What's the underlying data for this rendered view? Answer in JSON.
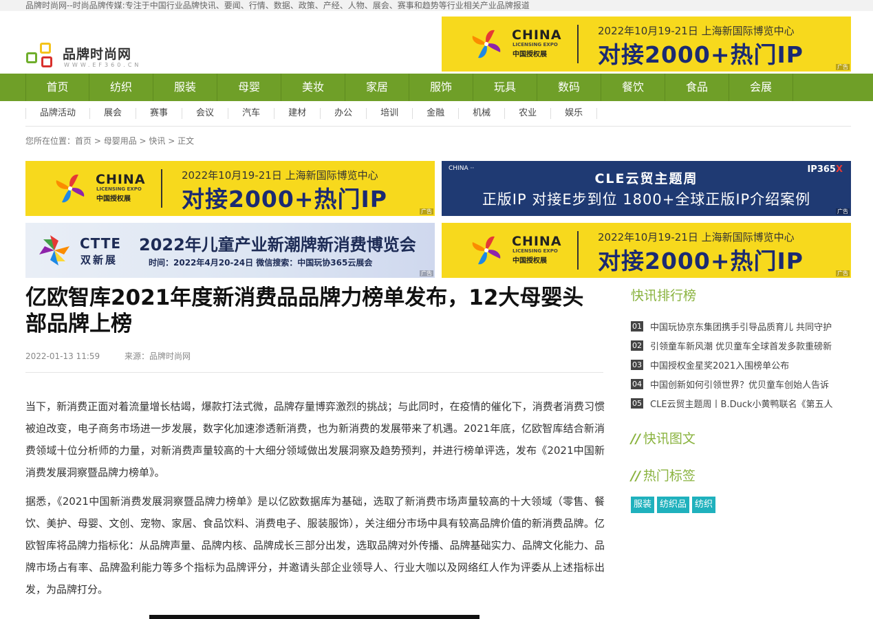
{
  "topbar": {
    "text": "品牌时尚网--时尚品牌传媒:专注于中国行业品牌快讯、要闻、行情、数据、政策、产经、人物、展会、赛事和趋势等行业相关产业品牌报道"
  },
  "logo": {
    "name": "品牌时尚网",
    "url": "WWW.EF360.CN"
  },
  "ad_yellow": {
    "china": "CHINA",
    "licensing": "LICENSING EXPO",
    "cn": "中国授权展",
    "date": "2022年10月19-21日 上海新国际博览中心",
    "headline": "对接2000+热门IP",
    "tag": "广告"
  },
  "ad_blue": {
    "title": "CLE云贸主题周",
    "subtitle": "正版IP 对接E步到位 1800+全球正版IP介绍案例",
    "brand": "IP365",
    "brand_x": "X",
    "logos": "CHINA ·· ",
    "tag": "广告"
  },
  "ad_ctte": {
    "en": "CTTE",
    "cn": "双新展",
    "title": "2022年儿童产业新潮牌新消费博览会",
    "info": "时间：2022年4月20-24日    微信搜索：中国玩协365云展会",
    "tag": "广告"
  },
  "nav": [
    "首页",
    "纺织",
    "服装",
    "母婴",
    "美妆",
    "家居",
    "服饰",
    "玩具",
    "数码",
    "餐饮",
    "食品",
    "会展"
  ],
  "subnav": [
    "品牌活动",
    "展会",
    "赛事",
    "会议",
    "汽车",
    "建材",
    "办公",
    "培训",
    "金融",
    "机械",
    "农业",
    "娱乐"
  ],
  "breadcrumb": {
    "prefix": "您所在位置：",
    "items": [
      "首页",
      "母婴用品",
      "快讯",
      "正文"
    ],
    "sep": " > "
  },
  "article": {
    "title": "亿欧智库2021年度新消费品品牌力榜单发布，12大母婴头部品牌上榜",
    "date": "2022-01-13 11:59",
    "source": "来源：品牌时尚网",
    "paragraphs": [
      "当下，新消费正面对着流量增长枯竭，爆款打法式微，品牌存量博弈激烈的挑战；与此同时，在疫情的催化下，消费者消费习惯被迫改变，电子商务市场进一步发展，数字化加速渗透新消费，也为新消费的发展带来了机遇。2021年底，亿欧智库结合新消费领域十位分析师的力量，对新消费声量较高的十大细分领域做出发展洞察及趋势预判，并进行榜单评选，发布《2021中国新消费发展洞察暨品牌力榜单》。",
      "据悉，《2021中国新消费发展洞察暨品牌力榜单》是以亿欧数据库为基础，选取了新消费市场声量较高的十大领域（零售、餐饮、美护、母婴、文创、宠物、家居、食品饮料、消费电子、服装服饰），关注细分市场中具有较高品牌价值的新消费品牌。亿欧智库将品牌力指标化：从品牌声量、品牌内核、品牌成长三部分出发，选取品牌对外传播、品牌基础实力、品牌文化能力、品牌市场占有率、品牌盈利能力等多个指标为品牌评分，并邀请头部企业领导人、行业大咖以及网络红人作为评委从上述指标出发，为品牌打分。"
    ]
  },
  "sidebar": {
    "rank_title": "快讯排行榜",
    "rank_items": [
      {
        "num": "01",
        "text": "中国玩协京东集团携手引导品质育儿 共同守护"
      },
      {
        "num": "02",
        "text": "引领童车新风潮 优贝童车全球首发多款重磅新"
      },
      {
        "num": "03",
        "text": "中国授权金星奖2021入围榜单公布"
      },
      {
        "num": "04",
        "text": "中国创新如何引领世界？优贝童车创始人告诉"
      },
      {
        "num": "05",
        "text": "CLE云贸主题周丨B.Duck小黄鸭联名《第五人"
      }
    ],
    "slashes": "//",
    "pic_title": "快讯图文",
    "tag_title": "热门标签",
    "tags": [
      "服装",
      "纺织品",
      "纺织"
    ]
  },
  "colors": {
    "nav_green": "#6f9f28",
    "accent_green": "#8ab33f",
    "tag_teal": "#1fb1bd",
    "banner_yellow": "#f7d91d",
    "banner_navy": "#1f3a73"
  }
}
